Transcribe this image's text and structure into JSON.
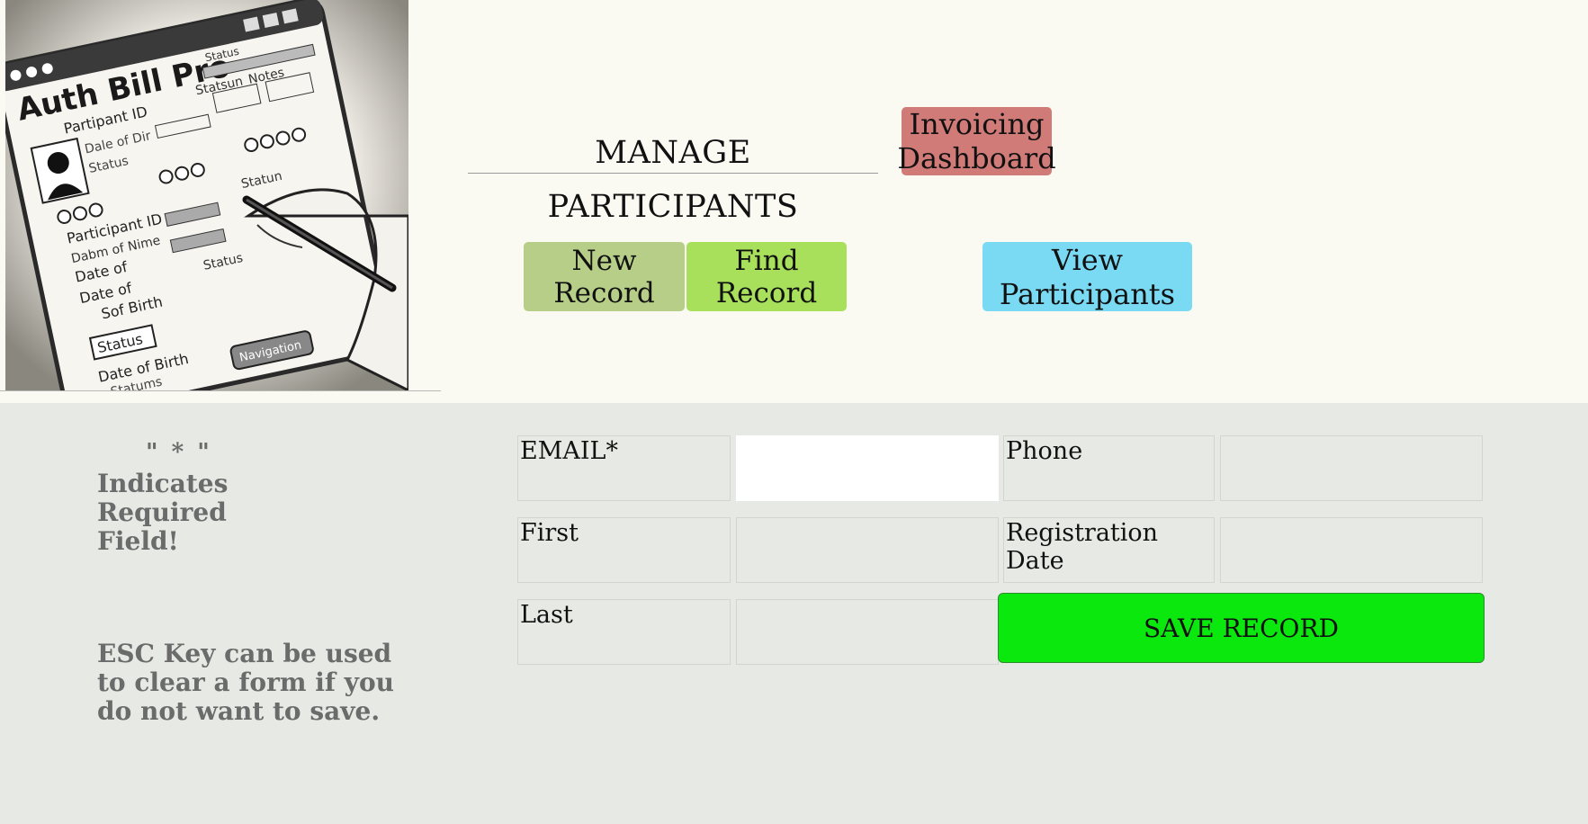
{
  "header": {
    "title": "MANAGE PARTICIPANTS",
    "invoicing_label": "Invoicing Dashboard",
    "new_record_label": "New Record",
    "find_record_label": "Find Record",
    "view_participants_label": "View Participants"
  },
  "logo": {
    "app_name": "Auth Bill Pro",
    "sketch_labels": [
      "Status",
      "Statsun",
      "Notes",
      "Partipant ID",
      "Dale of Dir",
      "Status",
      "Participant ID",
      "Dabm of Nime",
      "Date of",
      "Date of",
      "Sof Birth",
      "Status",
      "Status",
      "Date of Birth",
      "Statums",
      "Statun",
      "Navigation"
    ]
  },
  "notes": {
    "star": "\" * \"",
    "required": "Indicates Required Field!",
    "esc": "ESC Key can be used to clear a form if you do not want to save."
  },
  "form": {
    "email_label": "EMAIL*",
    "email_value": "",
    "phone_label": "Phone",
    "phone_value": "",
    "first_label": "First",
    "first_value": "",
    "registration_label": "Registration Date",
    "registration_value": "",
    "last_label": "Last",
    "last_value": "",
    "save_label": "SAVE RECORD"
  },
  "colors": {
    "header_bg": "#fafaf3",
    "body_bg": "#e6e9e4",
    "invoicing": "#d07b78",
    "new_record": "#b6ce87",
    "find_record": "#a8e05c",
    "view_participants": "#7adaf4",
    "save": "#0ae80e"
  }
}
